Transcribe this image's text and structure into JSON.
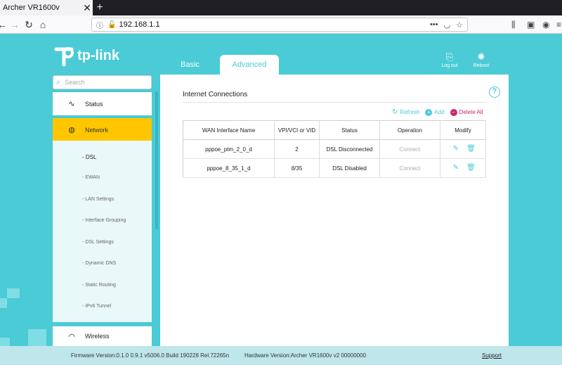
{
  "browser": {
    "tab_title": "Archer VR1600v",
    "tab_close": "✕",
    "new_tab": "+",
    "url": "192.168.1.1"
  },
  "header": {
    "logo_text": "tp-link",
    "tabs": [
      {
        "label": "Basic"
      },
      {
        "label": "Advanced"
      }
    ],
    "logout_label": "Log out",
    "reboot_label": "Reboot"
  },
  "sidebar": {
    "search_placeholder": "Search",
    "items": [
      {
        "label": "Status",
        "icon": "pulse-icon"
      },
      {
        "label": "Network",
        "icon": "globe-icon"
      },
      {
        "label": "Wireless",
        "icon": "wifi-icon"
      }
    ],
    "subitems": [
      {
        "label": "- DSL"
      },
      {
        "label": "- EWAN"
      },
      {
        "label": "- LAN Settings"
      },
      {
        "label": "- Interface Grouping"
      },
      {
        "label": "- DSL Settings"
      },
      {
        "label": "- Dynamic DNS"
      },
      {
        "label": "- Static Routing"
      },
      {
        "label": "- IPv6 Tunnel"
      }
    ]
  },
  "main": {
    "section_title": "Internet Connections",
    "actions": {
      "refresh": "Refresh",
      "add": "Add",
      "delete_all": "Delete All"
    },
    "columns": [
      "WAN Interface Name",
      "VPI/VCI or VID",
      "Status",
      "Operation",
      "Modify"
    ],
    "rows": [
      {
        "name": "pppoe_ptm_2_0_d",
        "vid": "2",
        "status": "DSL Disconnected",
        "operation": "Connect"
      },
      {
        "name": "pppoe_8_35_1_d",
        "vid": "8/35",
        "status": "DSL Disabled",
        "operation": "Connect"
      }
    ]
  },
  "footer": {
    "firmware": "Firmware Version:0.1.0 0.9.1 v5006.0 Build 190228 Rel.72265n",
    "hardware": "Hardware Version:Archer VR1600v v2 00000000",
    "support": "Support"
  },
  "colors": {
    "accent": "#4acbd6",
    "active_menu": "#ffc600",
    "delete": "#c8266f"
  }
}
